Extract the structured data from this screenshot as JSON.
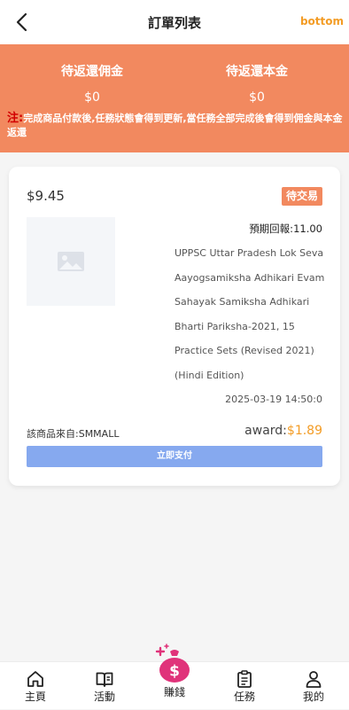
{
  "header": {
    "title": "訂單列表",
    "right_label": "bottom"
  },
  "banner": {
    "pending_commission_label": "待返還佣金",
    "pending_commission_value": "$0",
    "pending_principal_label": "待返還本金",
    "pending_principal_value": "$0",
    "notice_prefix": "注:",
    "notice_text": "完成商品付款後,任務狀態會得到更新,當任務全部完成後會得到佣金與本金返還"
  },
  "order": {
    "price": "$9.45",
    "status": "待交易",
    "expected_label": "預期回報:",
    "expected_value": "11.00",
    "product_title": "UPPSC Uttar Pradesh Lok Seva Aayogsamiksha Adhikari Evam Sahayak Samiksha Adhikari Bharti Pariksha-2021, 15 Practice Sets (Revised 2021) (Hindi Edition)",
    "time": "2025-03-19 14:50:0",
    "source": "該商品來自:SMMALL",
    "award_label": "award:",
    "award_value": "$1.89",
    "pay_button": "立即支付"
  },
  "tabbar": {
    "items": [
      {
        "label": "主頁",
        "icon": "home-icon"
      },
      {
        "label": "活動",
        "icon": "book-icon"
      },
      {
        "label": "賺錢",
        "icon": "money-bag-icon"
      },
      {
        "label": "任務",
        "icon": "clipboard-icon"
      },
      {
        "label": "我的",
        "icon": "user-icon"
      }
    ]
  },
  "colors": {
    "banner": "#f2895f",
    "accent": "#f39c25",
    "pay_button": "#86a9ef",
    "notice_prefix": "#d10000",
    "money_bag": "#e0337a"
  }
}
